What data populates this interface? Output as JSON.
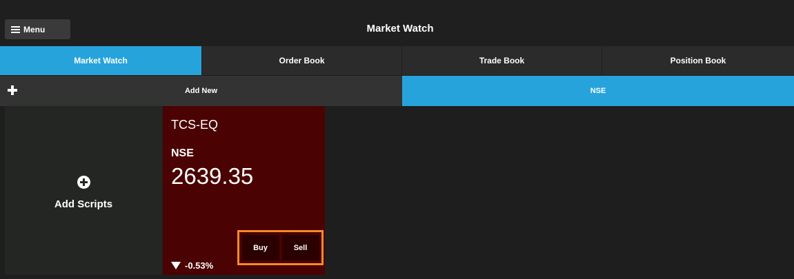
{
  "header": {
    "menu_label": "Menu",
    "title": "Market Watch"
  },
  "tabs": [
    {
      "label": "Market Watch",
      "active": true
    },
    {
      "label": "Order Book",
      "active": false
    },
    {
      "label": "Trade Book",
      "active": false
    },
    {
      "label": "Position Book",
      "active": false
    }
  ],
  "subbar": {
    "add_new_label": "Add New",
    "exchange_label": "NSE"
  },
  "add_scripts": {
    "label": "Add Scripts"
  },
  "script_card": {
    "symbol": "TCS-EQ",
    "exchange": "NSE",
    "price": "2639.35",
    "change": "-0.53%",
    "buy_label": "Buy",
    "sell_label": "Sell",
    "card_color": "#4a0302",
    "highlight_color": "#f38b2b"
  },
  "colors": {
    "accent": "#27a3dc",
    "background": "#1e1e1e"
  },
  "icons": {
    "menu": "hamburger-icon",
    "add": "plus-icon",
    "add_scripts": "circle-plus-icon",
    "change": "triangle-down-icon"
  }
}
